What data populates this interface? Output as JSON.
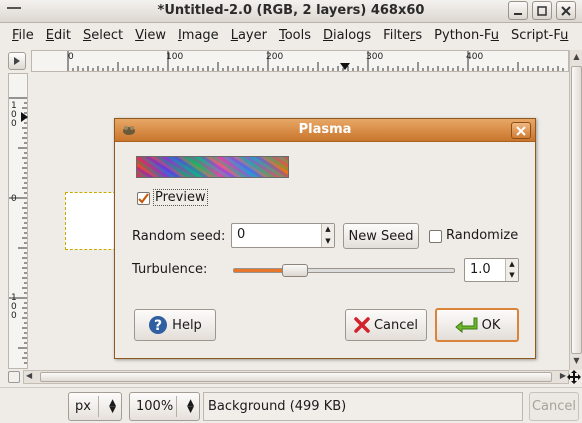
{
  "window": {
    "title": "*Untitled-2.0 (RGB, 2 layers) 468x60"
  },
  "menubar": {
    "items": [
      {
        "pre": "",
        "u": "F",
        "post": "ile"
      },
      {
        "pre": "",
        "u": "E",
        "post": "dit"
      },
      {
        "pre": "",
        "u": "S",
        "post": "elect"
      },
      {
        "pre": "",
        "u": "V",
        "post": "iew"
      },
      {
        "pre": "",
        "u": "I",
        "post": "mage"
      },
      {
        "pre": "",
        "u": "L",
        "post": "ayer"
      },
      {
        "pre": "",
        "u": "T",
        "post": "ools"
      },
      {
        "pre": "",
        "u": "D",
        "post": "ialogs"
      },
      {
        "pre": "Filte",
        "u": "r",
        "post": "s"
      },
      {
        "pre": "Python-F",
        "u": "u",
        "post": ""
      },
      {
        "pre": "Script-F",
        "u": "u",
        "post": ""
      }
    ]
  },
  "rulers": {
    "h_labels": [
      "0",
      "100",
      "200",
      "300",
      "400"
    ],
    "v_labels": [
      "1\n0\n0",
      "0",
      "1\n0\n0"
    ]
  },
  "statusbar": {
    "unit": "px",
    "zoom": "100%",
    "message": "Background (499 KB)",
    "cancel_label": "Cancel"
  },
  "dialog": {
    "title": "Plasma",
    "preview_label": "Preview",
    "preview_checked": true,
    "random_seed_label": "Random seed:",
    "random_seed_value": "0",
    "new_seed_label": "New Seed",
    "randomize_label": "Randomize",
    "randomize_checked": false,
    "turbulence_label": "Turbulence:",
    "turbulence_value": "1.0",
    "turbulence_min": 0.1,
    "turbulence_max": 7.0,
    "help_label": "Help",
    "cancel_label": "Cancel",
    "ok_label": "OK"
  },
  "colors": {
    "dialog_titlebar": "#d48a45",
    "slider_fill": "#e6772a",
    "ok_border": "#d9843a"
  }
}
